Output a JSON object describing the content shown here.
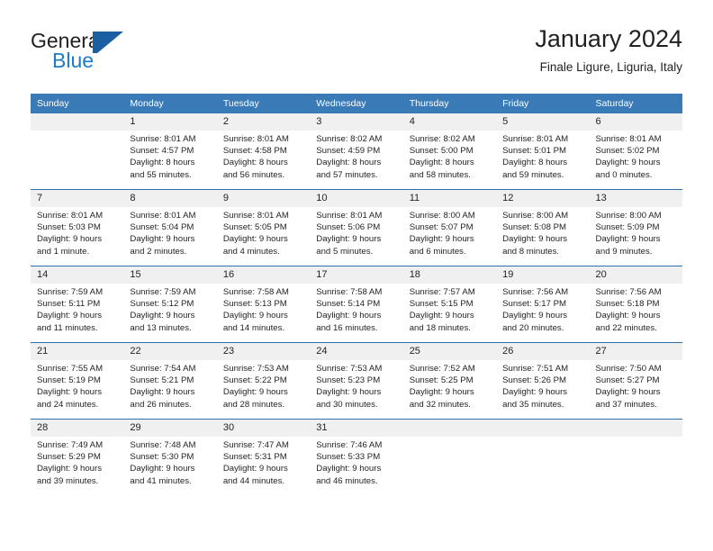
{
  "brand": {
    "name_top": "General",
    "name_bottom": "Blue",
    "logo_icon": "general-blue-triangle-logo",
    "accent_color": "#1e7bc8",
    "mark_color": "#1b5fa3"
  },
  "header": {
    "title": "January 2024",
    "subtitle": "Finale Ligure, Liguria, Italy"
  },
  "theme": {
    "header_blue": "#3a7ab7",
    "row_divider_blue": "#2f6fae",
    "daynum_band": "#f0f0f0",
    "text_color": "#231f20"
  },
  "calendar": {
    "weekday_headers": [
      "Sunday",
      "Monday",
      "Tuesday",
      "Wednesday",
      "Thursday",
      "Friday",
      "Saturday"
    ],
    "weeks": [
      [
        {
          "day": "",
          "sunrise": "",
          "sunset": "",
          "daylight_line1": "",
          "daylight_line2": ""
        },
        {
          "day": "1",
          "sunrise": "Sunrise: 8:01 AM",
          "sunset": "Sunset: 4:57 PM",
          "daylight_line1": "Daylight: 8 hours",
          "daylight_line2": "and 55 minutes."
        },
        {
          "day": "2",
          "sunrise": "Sunrise: 8:01 AM",
          "sunset": "Sunset: 4:58 PM",
          "daylight_line1": "Daylight: 8 hours",
          "daylight_line2": "and 56 minutes."
        },
        {
          "day": "3",
          "sunrise": "Sunrise: 8:02 AM",
          "sunset": "Sunset: 4:59 PM",
          "daylight_line1": "Daylight: 8 hours",
          "daylight_line2": "and 57 minutes."
        },
        {
          "day": "4",
          "sunrise": "Sunrise: 8:02 AM",
          "sunset": "Sunset: 5:00 PM",
          "daylight_line1": "Daylight: 8 hours",
          "daylight_line2": "and 58 minutes."
        },
        {
          "day": "5",
          "sunrise": "Sunrise: 8:01 AM",
          "sunset": "Sunset: 5:01 PM",
          "daylight_line1": "Daylight: 8 hours",
          "daylight_line2": "and 59 minutes."
        },
        {
          "day": "6",
          "sunrise": "Sunrise: 8:01 AM",
          "sunset": "Sunset: 5:02 PM",
          "daylight_line1": "Daylight: 9 hours",
          "daylight_line2": "and 0 minutes."
        }
      ],
      [
        {
          "day": "7",
          "sunrise": "Sunrise: 8:01 AM",
          "sunset": "Sunset: 5:03 PM",
          "daylight_line1": "Daylight: 9 hours",
          "daylight_line2": "and 1 minute."
        },
        {
          "day": "8",
          "sunrise": "Sunrise: 8:01 AM",
          "sunset": "Sunset: 5:04 PM",
          "daylight_line1": "Daylight: 9 hours",
          "daylight_line2": "and 2 minutes."
        },
        {
          "day": "9",
          "sunrise": "Sunrise: 8:01 AM",
          "sunset": "Sunset: 5:05 PM",
          "daylight_line1": "Daylight: 9 hours",
          "daylight_line2": "and 4 minutes."
        },
        {
          "day": "10",
          "sunrise": "Sunrise: 8:01 AM",
          "sunset": "Sunset: 5:06 PM",
          "daylight_line1": "Daylight: 9 hours",
          "daylight_line2": "and 5 minutes."
        },
        {
          "day": "11",
          "sunrise": "Sunrise: 8:00 AM",
          "sunset": "Sunset: 5:07 PM",
          "daylight_line1": "Daylight: 9 hours",
          "daylight_line2": "and 6 minutes."
        },
        {
          "day": "12",
          "sunrise": "Sunrise: 8:00 AM",
          "sunset": "Sunset: 5:08 PM",
          "daylight_line1": "Daylight: 9 hours",
          "daylight_line2": "and 8 minutes."
        },
        {
          "day": "13",
          "sunrise": "Sunrise: 8:00 AM",
          "sunset": "Sunset: 5:09 PM",
          "daylight_line1": "Daylight: 9 hours",
          "daylight_line2": "and 9 minutes."
        }
      ],
      [
        {
          "day": "14",
          "sunrise": "Sunrise: 7:59 AM",
          "sunset": "Sunset: 5:11 PM",
          "daylight_line1": "Daylight: 9 hours",
          "daylight_line2": "and 11 minutes."
        },
        {
          "day": "15",
          "sunrise": "Sunrise: 7:59 AM",
          "sunset": "Sunset: 5:12 PM",
          "daylight_line1": "Daylight: 9 hours",
          "daylight_line2": "and 13 minutes."
        },
        {
          "day": "16",
          "sunrise": "Sunrise: 7:58 AM",
          "sunset": "Sunset: 5:13 PM",
          "daylight_line1": "Daylight: 9 hours",
          "daylight_line2": "and 14 minutes."
        },
        {
          "day": "17",
          "sunrise": "Sunrise: 7:58 AM",
          "sunset": "Sunset: 5:14 PM",
          "daylight_line1": "Daylight: 9 hours",
          "daylight_line2": "and 16 minutes."
        },
        {
          "day": "18",
          "sunrise": "Sunrise: 7:57 AM",
          "sunset": "Sunset: 5:15 PM",
          "daylight_line1": "Daylight: 9 hours",
          "daylight_line2": "and 18 minutes."
        },
        {
          "day": "19",
          "sunrise": "Sunrise: 7:56 AM",
          "sunset": "Sunset: 5:17 PM",
          "daylight_line1": "Daylight: 9 hours",
          "daylight_line2": "and 20 minutes."
        },
        {
          "day": "20",
          "sunrise": "Sunrise: 7:56 AM",
          "sunset": "Sunset: 5:18 PM",
          "daylight_line1": "Daylight: 9 hours",
          "daylight_line2": "and 22 minutes."
        }
      ],
      [
        {
          "day": "21",
          "sunrise": "Sunrise: 7:55 AM",
          "sunset": "Sunset: 5:19 PM",
          "daylight_line1": "Daylight: 9 hours",
          "daylight_line2": "and 24 minutes."
        },
        {
          "day": "22",
          "sunrise": "Sunrise: 7:54 AM",
          "sunset": "Sunset: 5:21 PM",
          "daylight_line1": "Daylight: 9 hours",
          "daylight_line2": "and 26 minutes."
        },
        {
          "day": "23",
          "sunrise": "Sunrise: 7:53 AM",
          "sunset": "Sunset: 5:22 PM",
          "daylight_line1": "Daylight: 9 hours",
          "daylight_line2": "and 28 minutes."
        },
        {
          "day": "24",
          "sunrise": "Sunrise: 7:53 AM",
          "sunset": "Sunset: 5:23 PM",
          "daylight_line1": "Daylight: 9 hours",
          "daylight_line2": "and 30 minutes."
        },
        {
          "day": "25",
          "sunrise": "Sunrise: 7:52 AM",
          "sunset": "Sunset: 5:25 PM",
          "daylight_line1": "Daylight: 9 hours",
          "daylight_line2": "and 32 minutes."
        },
        {
          "day": "26",
          "sunrise": "Sunrise: 7:51 AM",
          "sunset": "Sunset: 5:26 PM",
          "daylight_line1": "Daylight: 9 hours",
          "daylight_line2": "and 35 minutes."
        },
        {
          "day": "27",
          "sunrise": "Sunrise: 7:50 AM",
          "sunset": "Sunset: 5:27 PM",
          "daylight_line1": "Daylight: 9 hours",
          "daylight_line2": "and 37 minutes."
        }
      ],
      [
        {
          "day": "28",
          "sunrise": "Sunrise: 7:49 AM",
          "sunset": "Sunset: 5:29 PM",
          "daylight_line1": "Daylight: 9 hours",
          "daylight_line2": "and 39 minutes."
        },
        {
          "day": "29",
          "sunrise": "Sunrise: 7:48 AM",
          "sunset": "Sunset: 5:30 PM",
          "daylight_line1": "Daylight: 9 hours",
          "daylight_line2": "and 41 minutes."
        },
        {
          "day": "30",
          "sunrise": "Sunrise: 7:47 AM",
          "sunset": "Sunset: 5:31 PM",
          "daylight_line1": "Daylight: 9 hours",
          "daylight_line2": "and 44 minutes."
        },
        {
          "day": "31",
          "sunrise": "Sunrise: 7:46 AM",
          "sunset": "Sunset: 5:33 PM",
          "daylight_line1": "Daylight: 9 hours",
          "daylight_line2": "and 46 minutes."
        },
        {
          "day": "",
          "sunrise": "",
          "sunset": "",
          "daylight_line1": "",
          "daylight_line2": ""
        },
        {
          "day": "",
          "sunrise": "",
          "sunset": "",
          "daylight_line1": "",
          "daylight_line2": ""
        },
        {
          "day": "",
          "sunrise": "",
          "sunset": "",
          "daylight_line1": "",
          "daylight_line2": ""
        }
      ]
    ]
  }
}
